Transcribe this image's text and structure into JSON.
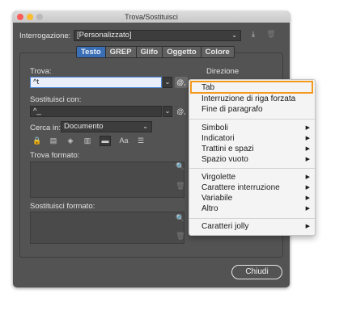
{
  "window": {
    "title": "Trova/Sostituisci"
  },
  "query": {
    "label": "Interrogazione:",
    "value": "[Personalizzato]"
  },
  "tabs": [
    "Testo",
    "GREP",
    "Glifo",
    "Oggetto",
    "Colore"
  ],
  "find": {
    "label": "Trova:",
    "value": "^t"
  },
  "replace": {
    "label": "Sostituisci con:",
    "value": "^_"
  },
  "direction": {
    "label": "Direzione"
  },
  "search_in": {
    "label": "Cerca in:",
    "value": "Documento"
  },
  "options_icons": [
    "locked-layers-icon",
    "locked-stories-icon",
    "hidden-layers-icon",
    "master-pages-icon",
    "footnotes-icon",
    "case-sensitive-icon",
    "whole-word-icon"
  ],
  "find_format": {
    "label": "Trova formato:"
  },
  "replace_format": {
    "label": "Sostituisci formato:"
  },
  "close_button": "Chiudi",
  "menu": {
    "group1": [
      "Tab",
      "Interruzione di riga forzata",
      "Fine di paragrafo"
    ],
    "group2": [
      "Simboli",
      "Indicatori",
      "Trattini e spazi",
      "Spazio vuoto"
    ],
    "group3": [
      "Virgolette",
      "Carattere interruzione",
      "Variabile",
      "Altro"
    ],
    "group4": [
      "Caratteri jolly"
    ],
    "highlighted": "Tab"
  },
  "colors": {
    "accent": "#3a6fb5",
    "highlight": "#f39a1e",
    "dialog_bg": "#535353"
  }
}
